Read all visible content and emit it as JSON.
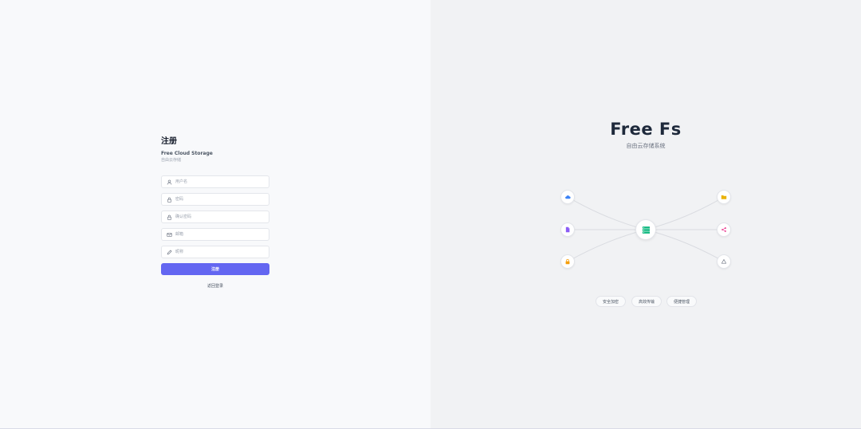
{
  "register": {
    "title": "注册",
    "subtitle": "Free Cloud Storage",
    "subtitle_cn": "自由云存储",
    "fields": [
      {
        "icon": "user-icon",
        "placeholder": "用户名",
        "value": ""
      },
      {
        "icon": "lock-icon",
        "placeholder": "密码",
        "value": ""
      },
      {
        "icon": "lock-icon",
        "placeholder": "确认密码",
        "value": ""
      },
      {
        "icon": "mail-icon",
        "placeholder": "邮箱",
        "value": ""
      },
      {
        "icon": "pencil-icon",
        "placeholder": "昵称",
        "value": ""
      }
    ],
    "submit_label": "注册",
    "back_label": "返回登录"
  },
  "brand": {
    "title": "Free Fs",
    "subtitle": "自由云存储系统"
  },
  "diagram": {
    "hub_icon": "server-icon",
    "nodes": [
      {
        "icon": "cloud-icon",
        "color": "#3b82f6"
      },
      {
        "icon": "file-icon",
        "color": "#8b5cf6"
      },
      {
        "icon": "lock-icon",
        "color": "#f59e0b"
      },
      {
        "icon": "folder-icon",
        "color": "#eab308"
      },
      {
        "icon": "share-icon",
        "color": "#ec4899"
      },
      {
        "icon": "recycle-icon",
        "color": "#6b7280"
      }
    ],
    "hub_color": "#10b981",
    "line_color": "#d9dbe0"
  },
  "features": [
    "安全加密",
    "高效传输",
    "便捷管理"
  ],
  "colors": {
    "accent": "#6366f1",
    "left_bg": "#f8f9fb",
    "right_bg": "#f1f2f4"
  }
}
